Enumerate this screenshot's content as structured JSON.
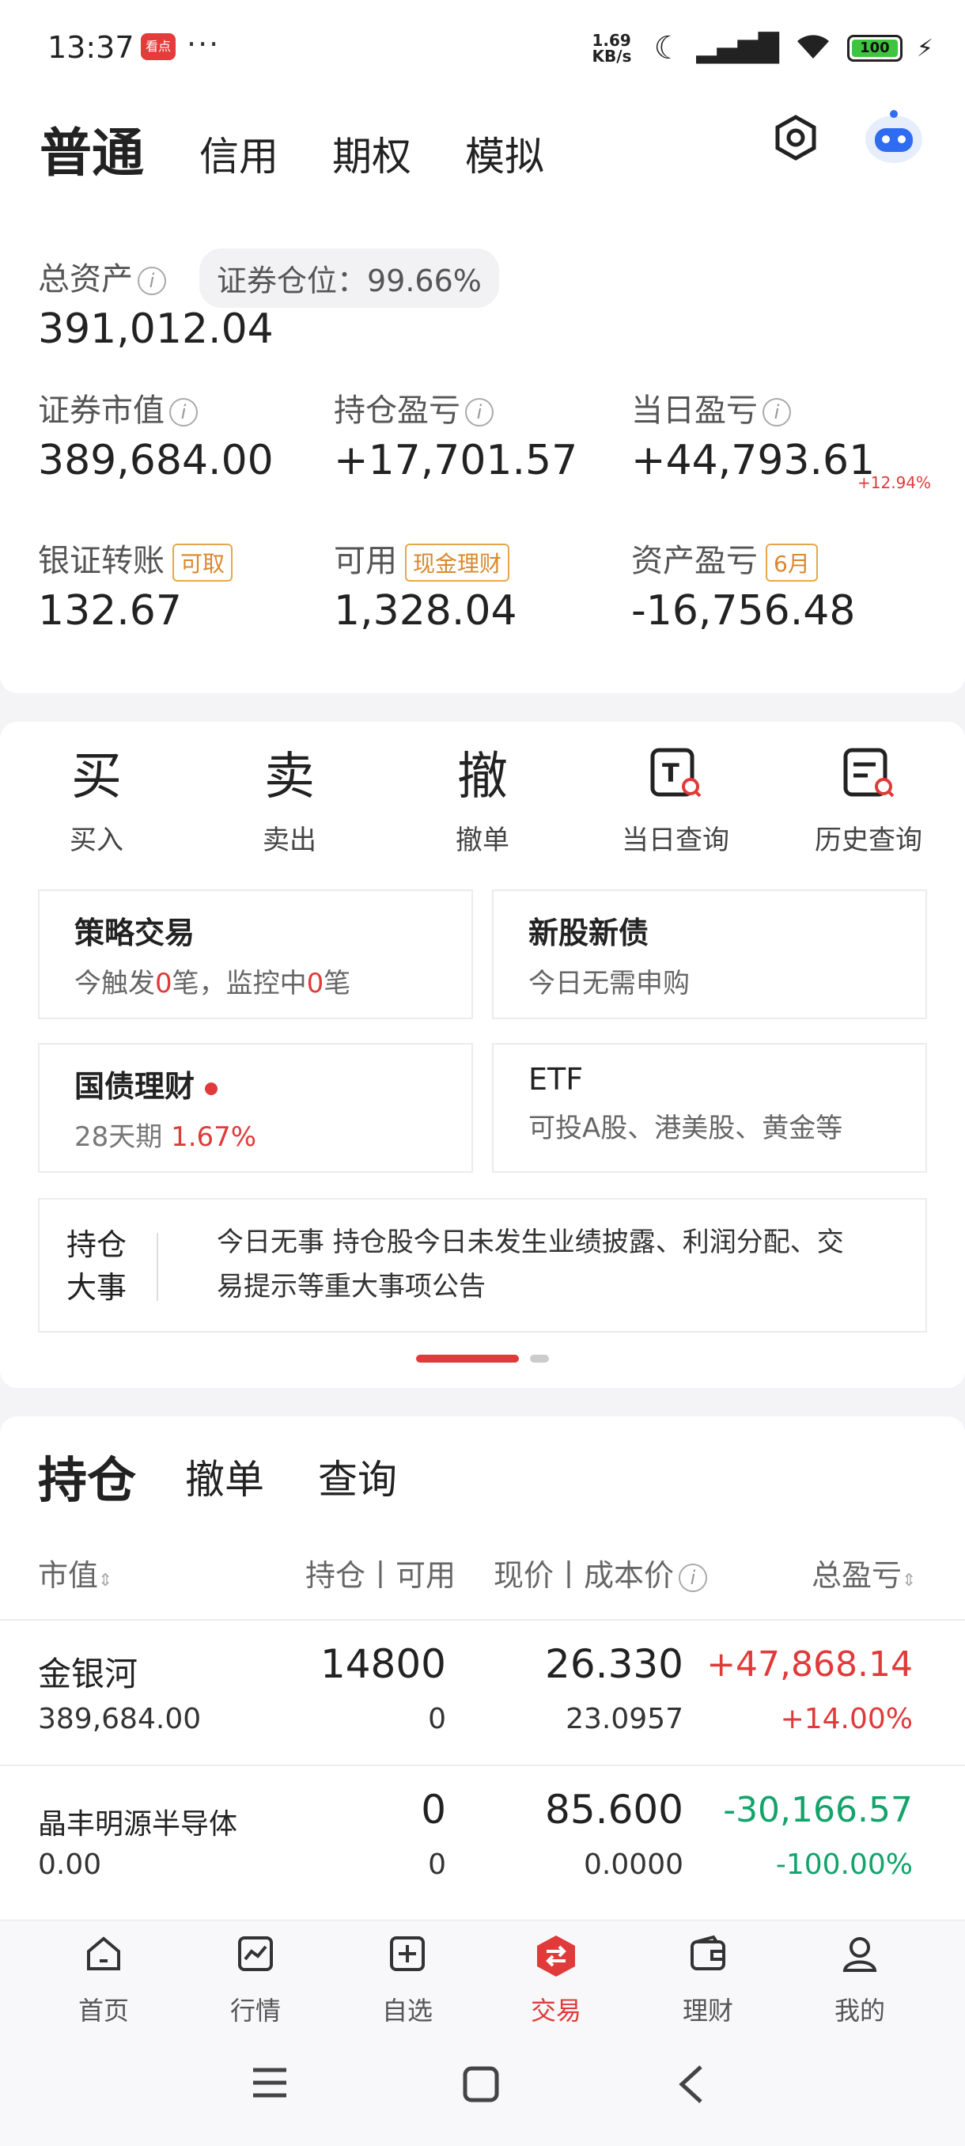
{
  "status": {
    "time": "13:37",
    "app_icon_text": "看点",
    "dots": "···",
    "speed": "1.69 KB/s",
    "battery": "100"
  },
  "accounts": [
    "普通",
    "信用",
    "期权",
    "模拟"
  ],
  "assets": {
    "total_label": "总资产",
    "position_pill": "证券仓位：99.66%",
    "total_value": "391,012.04",
    "market_value_label": "证券市值",
    "market_value": "389,684.00",
    "holding_pl_label": "持仓盈亏",
    "holding_pl": "+17,701.57",
    "daily_pl_label": "当日盈亏",
    "daily_pl": "+44,793.61",
    "daily_pl_pct": "+12.94%",
    "transfer_label": "银证转账",
    "transfer_tag": "可取",
    "transfer_value": "132.67",
    "available_label": "可用",
    "available_tag": "现金理财",
    "available_value": "1,328.04",
    "asset_pl_label": "资产盈亏",
    "asset_pl_tag": "6月",
    "asset_pl_value": "-16,756.48"
  },
  "actions": [
    {
      "label": "买入",
      "glyph": "买"
    },
    {
      "label": "卖出",
      "glyph": "卖"
    },
    {
      "label": "撤单",
      "glyph": "撤"
    },
    {
      "label": "当日查询",
      "glyph": "T"
    },
    {
      "label": "历史查询",
      "glyph": "≡"
    }
  ],
  "tiles": {
    "strategy_title": "策略交易",
    "strategy_sub_a": "今触发",
    "strategy_sub_n1": "0",
    "strategy_sub_b": "笔，监控中",
    "strategy_sub_n2": "0",
    "strategy_sub_c": "笔",
    "ipo_title": "新股新债",
    "ipo_sub": "今日无需申购",
    "bond_title": "国债理财",
    "bond_sub_a": "28天期",
    "bond_sub_b": "1.67%",
    "etf_title": "ETF",
    "etf_sub": "可投A股、港美股、黄金等"
  },
  "news": {
    "title_line1": "持仓",
    "title_line2": "大事",
    "text_line1": "今日无事 持仓股今日未发生业绩披露、利润分配、交",
    "text_line2": "易提示等重大事项公告"
  },
  "holdings": {
    "tabs": [
      "持仓",
      "撤单",
      "查询"
    ],
    "headers": {
      "market": "市值",
      "qty": "持仓丨可用",
      "price": "现价丨成本价",
      "pl": "总盈亏"
    },
    "rows": [
      {
        "name": "金银河",
        "market": "389,684.00",
        "qty": "14800",
        "avail": "0",
        "price": "26.330",
        "cost": "23.0957",
        "pl": "+47,868.14",
        "pl_pct": "+14.00%"
      },
      {
        "name": "晶丰明源半导体",
        "market": "0.00",
        "qty": "0",
        "avail": "0",
        "price": "85.600",
        "cost": "0.0000",
        "pl": "-30,166.57",
        "pl_pct": "-100.00%"
      }
    ]
  },
  "nav": [
    "首页",
    "行情",
    "自选",
    "交易",
    "理财",
    "我的"
  ]
}
